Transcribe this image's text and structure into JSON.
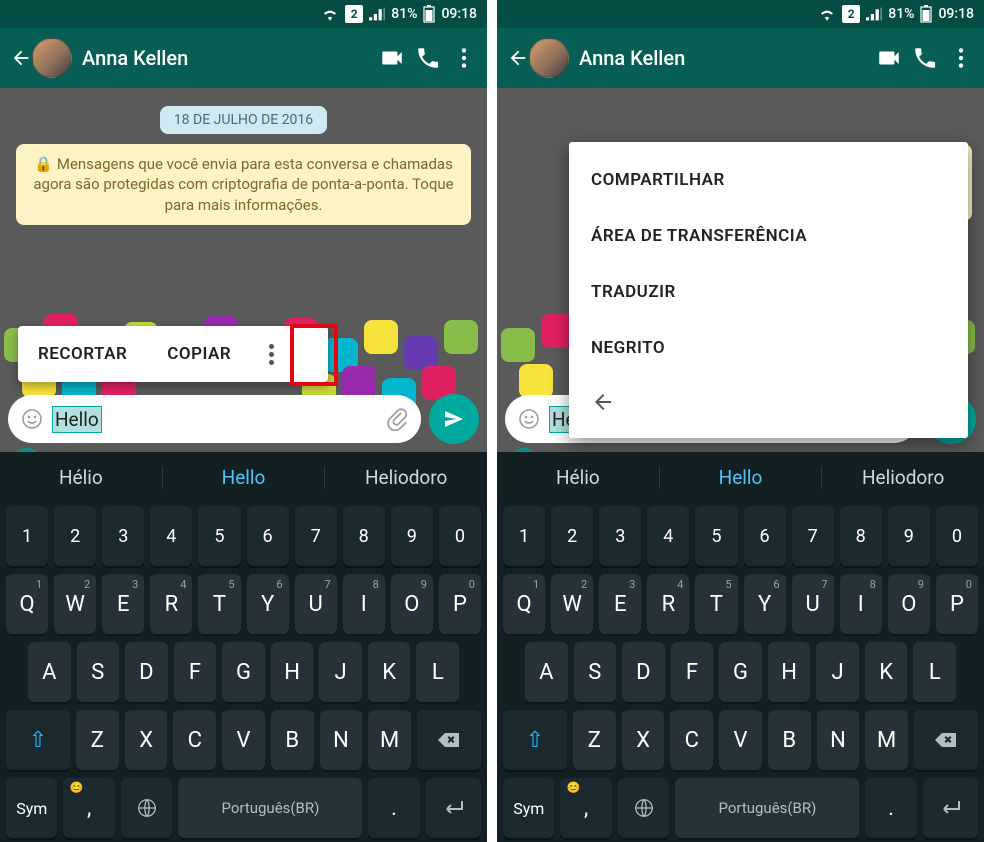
{
  "status": {
    "sim": "2",
    "battery": "81%",
    "time": "09:18"
  },
  "chat": {
    "contact_name": "Anna Kellen",
    "date_chip": "18 DE JULHO DE 2016",
    "encryption_notice": "Mensagens que você envia para esta conversa e chamadas agora são protegidas com criptografia de ponta-a-ponta. Toque para mais informações.",
    "input_text": "Hello"
  },
  "text_select_popup": {
    "cut": "RECORTAR",
    "copy": "COPIAR"
  },
  "extended_menu": {
    "share": "COMPARTILHAR",
    "clipboard": "ÁREA DE TRANSFERÊNCIA",
    "translate": "TRADUZIR",
    "bold": "NEGRITO"
  },
  "suggestions": {
    "s1": "Hélio",
    "s2": "Hello",
    "s3": "Heliodoro"
  },
  "keyboard": {
    "numbers": [
      "1",
      "2",
      "3",
      "4",
      "5",
      "6",
      "7",
      "8",
      "9",
      "0"
    ],
    "row1": [
      "Q",
      "W",
      "E",
      "R",
      "T",
      "Y",
      "U",
      "I",
      "O",
      "P"
    ],
    "row2": [
      "A",
      "S",
      "D",
      "F",
      "G",
      "H",
      "J",
      "K",
      "L"
    ],
    "row3": [
      "Z",
      "X",
      "C",
      "V",
      "B",
      "N",
      "M"
    ],
    "sym_label": "Sym",
    "space_label": "Português(BR)",
    "period": "."
  }
}
